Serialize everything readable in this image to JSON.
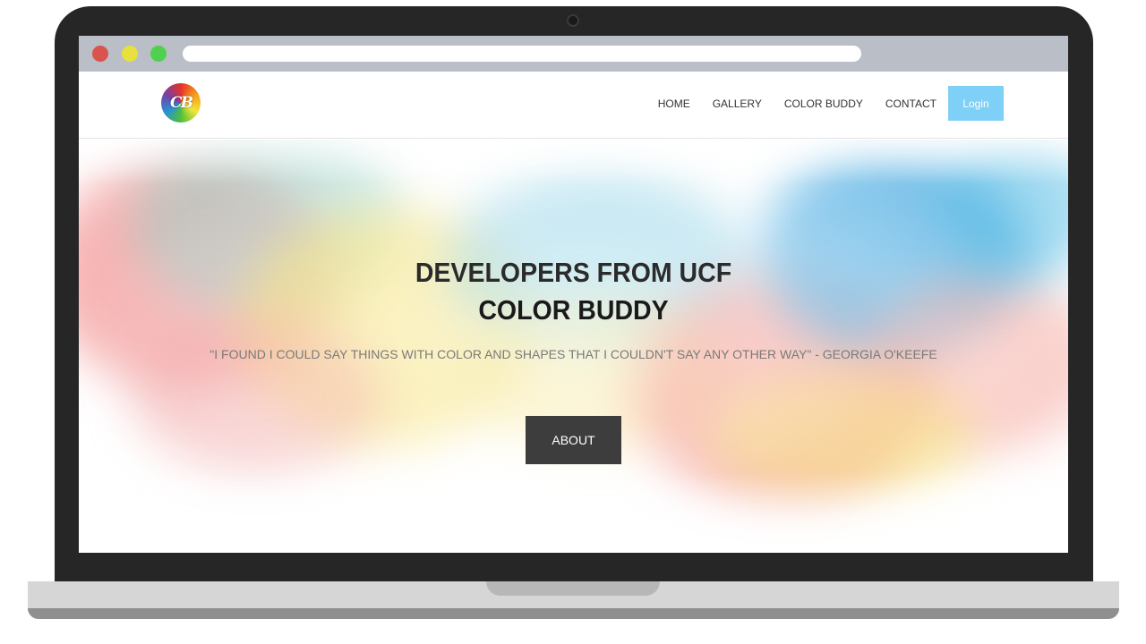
{
  "nav": {
    "logo_text": "CB",
    "links": [
      "HOME",
      "GALLERY",
      "COLOR BUDDY",
      "CONTACT"
    ],
    "login_label": "Login"
  },
  "hero": {
    "title_line1": "DEVELOPERS FROM UCF",
    "title_line2": "COLOR BUDDY",
    "quote": "\"I FOUND I COULD SAY THINGS WITH COLOR AND SHAPES THAT I COULDN'T SAY ANY OTHER WAY\" - GEORGIA O'KEEFE",
    "about_label": "ABOUT"
  },
  "colors": {
    "login_bg": "#7fd0f6",
    "about_bg": "#3d3d3d",
    "browser_bar": "#babec6",
    "laptop_frame": "#262626",
    "traffic_red": "#d9534f",
    "traffic_yellow": "#e8e03c",
    "traffic_green": "#4fd14f"
  },
  "icons": {
    "logo": "color-buddy-logo",
    "camera": "webcam-icon"
  }
}
